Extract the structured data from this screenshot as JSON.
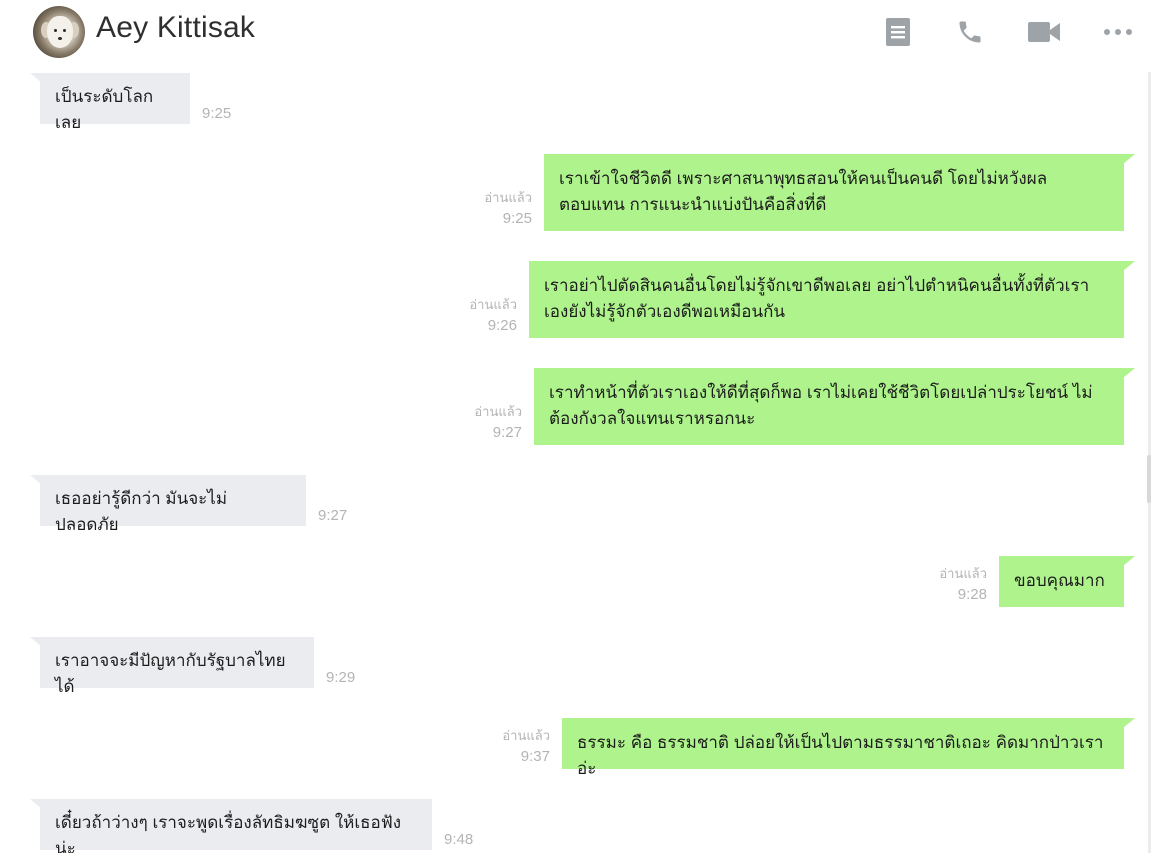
{
  "header": {
    "contact_name": "Aey Kittisak",
    "icons": [
      "notes-icon",
      "phone-icon",
      "video-call-icon",
      "more-icon"
    ]
  },
  "messages": [
    {
      "side": "in",
      "text": "เป็นระดับโลกเลย",
      "time": "9:25"
    },
    {
      "side": "out",
      "text": "เราเข้าใจชีวิตดี เพราะศาสนาพุทธสอนให้คนเป็นคนดี โดยไม่หวังผลตอบแทน การแนะนำแบ่งปันคือสิ่งที่ดี",
      "read": "อ่านแล้ว",
      "time": "9:25"
    },
    {
      "side": "out",
      "text": "เราอย่าไปตัดสินคนอื่นโดยไม่รู้จักเขาดีพอเลย อย่าไปตำหนิคนอื่นทั้งที่ตัวเราเองยังไม่รู้จักตัวเองดีพอเหมือนกัน",
      "read": "อ่านแล้ว",
      "time": "9:26"
    },
    {
      "side": "out",
      "text": "เราทำหน้าที่ตัวเราเองให้ดีที่สุดก็พอ เราไม่เคยใช้ชีวิตโดยเปล่าประโยชน์ ไม่ต้องกังวลใจแทนเราหรอกนะ",
      "read": "อ่านแล้ว",
      "time": "9:27"
    },
    {
      "side": "in",
      "text": "เธออย่ารู้ดีกว่า มันจะไม่ปลอดภัย",
      "time": "9:27"
    },
    {
      "side": "out",
      "text": "ขอบคุณมาก",
      "read": "อ่านแล้ว",
      "time": "9:28"
    },
    {
      "side": "in",
      "text": "เราอาจจะมีปัญหากับรัฐบาลไทยได้",
      "time": "9:29"
    },
    {
      "side": "out",
      "text": "ธรรมะ คือ ธรรมชาติ ปล่อยให้เป็นไปตามธรรมาชาติเถอะ คิดมากป่าวเราอ่ะ",
      "read": "อ่านแล้ว",
      "time": "9:37"
    },
    {
      "side": "in",
      "text": "เดี๋ยวถ้าว่างๆ เราจะพูดเรื่องลัทธิมฆซูต ให้เธอฟังน่ะ",
      "time": "9:48"
    }
  ],
  "colors": {
    "outgoing_bubble": "#aef38b",
    "incoming_bubble": "#eaecf0",
    "meta_text": "#b4b4b4",
    "icon_gray": "#9ea3a8"
  }
}
